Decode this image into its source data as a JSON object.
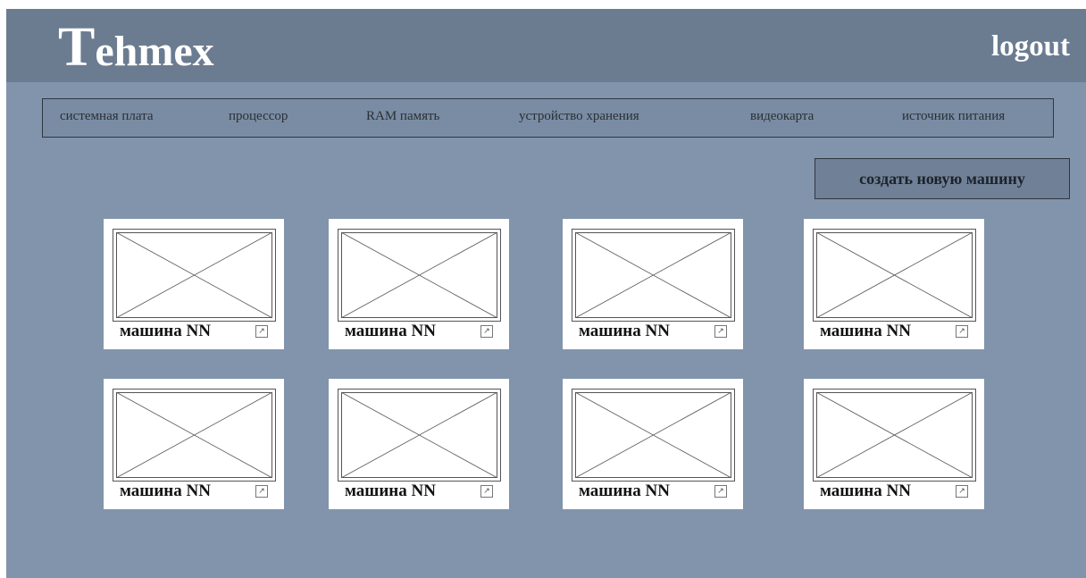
{
  "app": {
    "logo_big": "T",
    "logo_rest": "ehmex",
    "logout_label": "logout"
  },
  "nav": {
    "items": [
      {
        "label": "системная плата"
      },
      {
        "label": "процессор"
      },
      {
        "label": "RAM память"
      },
      {
        "label": "устройство хранения"
      },
      {
        "label": "видеокарта"
      },
      {
        "label": "источник питания"
      }
    ]
  },
  "actions": {
    "create_label": "создать новую машину"
  },
  "cards": [
    {
      "label": "машина NN",
      "open_icon": "external-link-icon"
    },
    {
      "label": "машина NN",
      "open_icon": "external-link-icon"
    },
    {
      "label": "машина NN",
      "open_icon": "external-link-icon"
    },
    {
      "label": "машина NN",
      "open_icon": "external-link-icon"
    },
    {
      "label": "машина NN",
      "open_icon": "external-link-icon"
    },
    {
      "label": "машина NN",
      "open_icon": "external-link-icon"
    },
    {
      "label": "машина NN",
      "open_icon": "external-link-icon"
    },
    {
      "label": "машина NN",
      "open_icon": "external-link-icon"
    }
  ],
  "colors": {
    "background": "#8194ab",
    "header": "#6b7c91",
    "card": "#ffffff"
  }
}
